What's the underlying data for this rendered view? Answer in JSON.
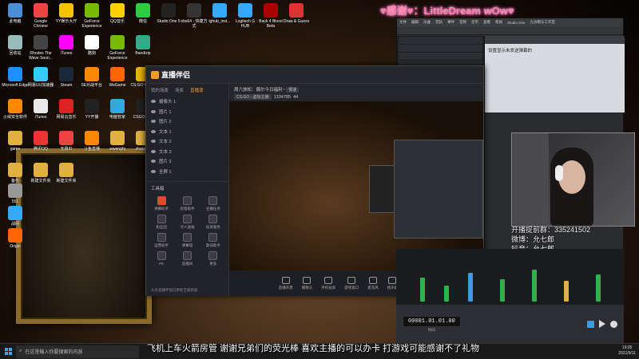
{
  "overlay_title": "♥感谢♥：LittleDream wOw♥",
  "desktop_icons": [
    {
      "label": "此电脑",
      "color": "#4a90d9"
    },
    {
      "label": "Google Chrome",
      "color": "#e44"
    },
    {
      "label": "YY娱乐大厅",
      "color": "#f5c300"
    },
    {
      "label": "GeForce Experience",
      "color": "#76b900"
    },
    {
      "label": "QQ音乐",
      "color": "#ffd000"
    },
    {
      "label": "微信",
      "color": "#2ecc40"
    },
    {
      "label": "Studio One 5",
      "color": "#222"
    },
    {
      "label": "obs64 - 快捷方式",
      "color": "#333"
    },
    {
      "label": "lghub_inst...",
      "color": "#3af"
    },
    {
      "label": "Logitech G HUB",
      "color": "#3af"
    },
    {
      "label": "Back 4 Blood Beta",
      "color": "#a00"
    },
    {
      "label": "Draw & Guess",
      "color": "#d33"
    },
    {
      "label": "回收站",
      "color": "#9bb"
    },
    {
      "label": "Rhodes The Wave Soun...",
      "color": "#444"
    },
    {
      "label": "iTunes",
      "color": "#f0f"
    },
    {
      "label": "酷狗",
      "color": "#fff"
    },
    {
      "label": "GeForce Experience",
      "color": "#76b900"
    },
    {
      "label": "Bandizip",
      "color": "#3a8"
    },
    {
      "label": "Microsoft Edge",
      "color": "#1e90ff"
    },
    {
      "label": "网易UU加速器",
      "color": "#3cf"
    },
    {
      "label": "Steam",
      "color": "#1b2838"
    },
    {
      "label": "5E对战平台",
      "color": "#f80"
    },
    {
      "label": "WeGame",
      "color": "#f60"
    },
    {
      "label": "CS:GO Game",
      "color": "#e8b300"
    },
    {
      "label": "火绒安全软件",
      "color": "#f80"
    },
    {
      "label": "iTunes",
      "color": "#eaeaea"
    },
    {
      "label": "网易云音乐",
      "color": "#d22"
    },
    {
      "label": "YY开播",
      "color": "#222"
    },
    {
      "label": "电脑管家",
      "color": "#3ad"
    },
    {
      "label": "CSGO工具",
      "color": "#222"
    },
    {
      "label": "game",
      "color": "#e0b040"
    },
    {
      "label": "腾讯QQ",
      "color": "#e33"
    },
    {
      "label": "无畏ID",
      "color": "#e44"
    },
    {
      "label": "斗鱼直播",
      "color": "#f80"
    },
    {
      "label": "wwenghj",
      "color": "#e0b040"
    },
    {
      "label": "zhaojian",
      "color": "#e0b040"
    },
    {
      "label": "备份",
      "color": "#e0b040"
    },
    {
      "label": "新建文件夹",
      "color": "#e0b040"
    },
    {
      "label": "新建文件夹",
      "color": "#e0b040"
    },
    {
      "label": "551",
      "color": "#999"
    },
    {
      "label": "战网",
      "color": "#3af"
    },
    {
      "label": "Origin",
      "color": "#f60"
    }
  ],
  "obs": {
    "app_name": "直播伴侣",
    "left_tabs": [
      "我的场景",
      "场景",
      "直播源"
    ],
    "sources": [
      "摄像头 1",
      "图片 1",
      "图片 2",
      "文本 1",
      "文本 2",
      "文本 3",
      "图片 3",
      "全屏 1"
    ],
    "tools_title": "工具箱",
    "tools": [
      "弹幕助手",
      "房管助手",
      "主播任务",
      "粉丝团",
      "点人送福",
      "投屏服务",
      "运营助手",
      "弹幕墙",
      "歌词助手",
      "PK",
      "直播间",
      "更多"
    ],
    "notice": "头条直播伴侣已更新至最新版",
    "stream_title": "周六放松：偶尔今日福利~",
    "stream_tag": "慢速",
    "category": "CS:GO - 虚拟主播",
    "viewer_count": "1334785",
    "like_count": "44",
    "bottom_buttons": [
      "直播背景",
      "摄像头",
      "手机投屏",
      "游戏窗口",
      "麦克风",
      "扬声器"
    ],
    "live_button": "开始直播"
  },
  "daw": {
    "menu": [
      "文件",
      "编辑",
      "乐曲",
      "音轨",
      "事件",
      "音频",
      "走带",
      "查看",
      "帮助",
      "Studio One",
      "九洲看乐工作室"
    ],
    "panel_text": "设置显示未发送弹幕的",
    "timecode": "00001.01.01.00",
    "time_label": "时间"
  },
  "webcam_overlay": [
    "开播提前群：335241502",
    "微博：允七郎",
    "抖音：允七郎"
  ],
  "danmu": "飞机上车火箭房管 谢谢兄弟们的荧光棒 喜欢主播的可以办卡 打游戏可能感谢不了礼物",
  "taskbar": {
    "search_placeholder": "在这里输入你要搜索的内容",
    "time": "19:05",
    "date": "2021/9/11"
  }
}
